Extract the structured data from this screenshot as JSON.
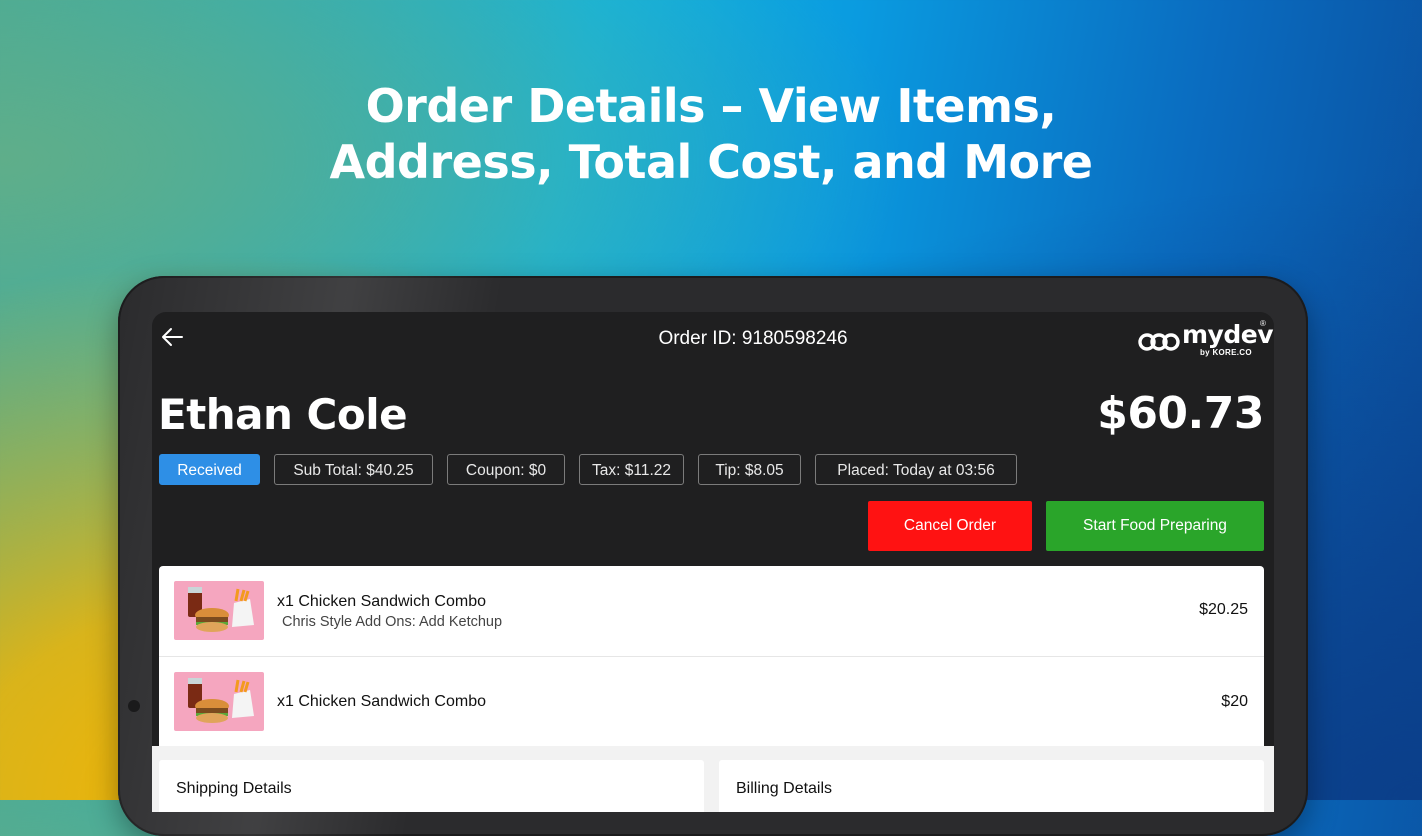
{
  "headline": {
    "line1": "Order Details – View Items,",
    "line2": "Address, Total Cost, and More"
  },
  "topbar": {
    "order_id": "Order ID: 9180598246",
    "brand": "mydev",
    "brand_reg": "®",
    "brand_by": "by KORE.CO"
  },
  "order": {
    "customer_name": "Ethan Cole",
    "total": "$60.73",
    "chips": {
      "status": "Received",
      "subtotal": "Sub Total: $40.25",
      "coupon": "Coupon: $0",
      "tax": "Tax: $11.22",
      "tip": "Tip: $8.05",
      "placed": "Placed: Today at 03:56"
    }
  },
  "actions": {
    "cancel": "Cancel Order",
    "start": "Start Food Preparing"
  },
  "items": [
    {
      "name": "x1 Chicken Sandwich Combo",
      "details": "Chris Style Add Ons: Add Ketchup",
      "price": "$20.25"
    },
    {
      "name": "x1 Chicken Sandwich Combo",
      "details": "",
      "price": "$20"
    }
  ],
  "sections": {
    "shipping": "Shipping Details",
    "billing": "Billing Details"
  },
  "colors": {
    "status_chip": "#2e8fe6",
    "cancel": "#ff1212",
    "start": "#2aa52a",
    "screen_bg": "#1f1f20"
  },
  "icons": {
    "back": "arrow-left-icon",
    "logo": "mydev-logo-icon"
  }
}
